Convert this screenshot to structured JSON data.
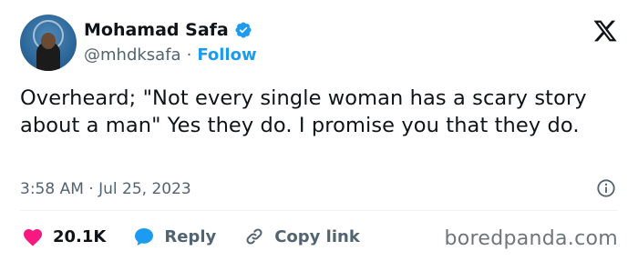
{
  "author": {
    "name": "Mohamad Safa",
    "handle": "@mhdksafa",
    "separator": "·",
    "follow_label": "Follow"
  },
  "tweet": {
    "text": "Overheard; \"Not every single woman has a scary story about a man\" Yes they do. I promise you that they do.",
    "time": "3:58 AM",
    "date_separator": "·",
    "date": "Jul 25, 2023"
  },
  "actions": {
    "like_count": "20.1K",
    "reply_label": "Reply",
    "copy_link_label": "Copy link"
  },
  "watermark": "boredpanda.com",
  "colors": {
    "like": "#f91880",
    "reply": "#1d9bf0",
    "verified": "#1d9bf0",
    "follow": "#1d9bf0"
  },
  "icons": [
    "verified-badge-icon",
    "x-logo-icon",
    "info-icon",
    "heart-icon",
    "reply-bubble-icon",
    "link-icon"
  ]
}
